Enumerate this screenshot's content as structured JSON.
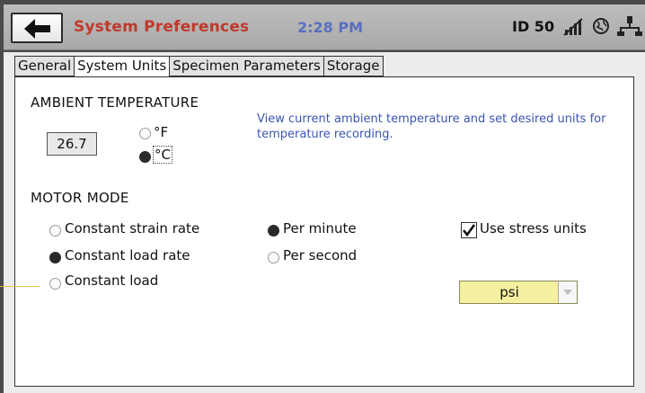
{
  "header": {
    "title": "System Preferences",
    "time": "2:28 PM",
    "device_id": "ID 50",
    "icons": [
      "back-arrow-icon",
      "no-signal-icon",
      "globe-icon",
      "network-icon"
    ]
  },
  "tabs": [
    {
      "label": "General",
      "active": false
    },
    {
      "label": "System Units",
      "active": true
    },
    {
      "label": "Specimen Parameters",
      "active": false
    },
    {
      "label": "Storage",
      "active": false
    }
  ],
  "ambient": {
    "heading": "AMBIENT TEMPERATURE",
    "value": "26.7",
    "unit_f": "°F",
    "unit_c": "°C",
    "selected": "°C",
    "help": "View current ambient temperature and set desired units for temperature recording."
  },
  "motor": {
    "heading": "MOTOR MODE",
    "modes": [
      "Constant strain rate",
      "Constant load rate",
      "Constant load"
    ],
    "selected_mode": "Constant load rate",
    "rates": [
      "Per minute",
      "Per second"
    ],
    "selected_rate": "Per minute",
    "stress_units_label": "Use stress units",
    "stress_units_checked": true,
    "units_value": "psi"
  },
  "colors": {
    "title": "#c0392b",
    "time": "#5a6fc0",
    "help_text": "#3a55b0",
    "select_bg": "#f4f0a0",
    "callout": "#e6c24a"
  }
}
